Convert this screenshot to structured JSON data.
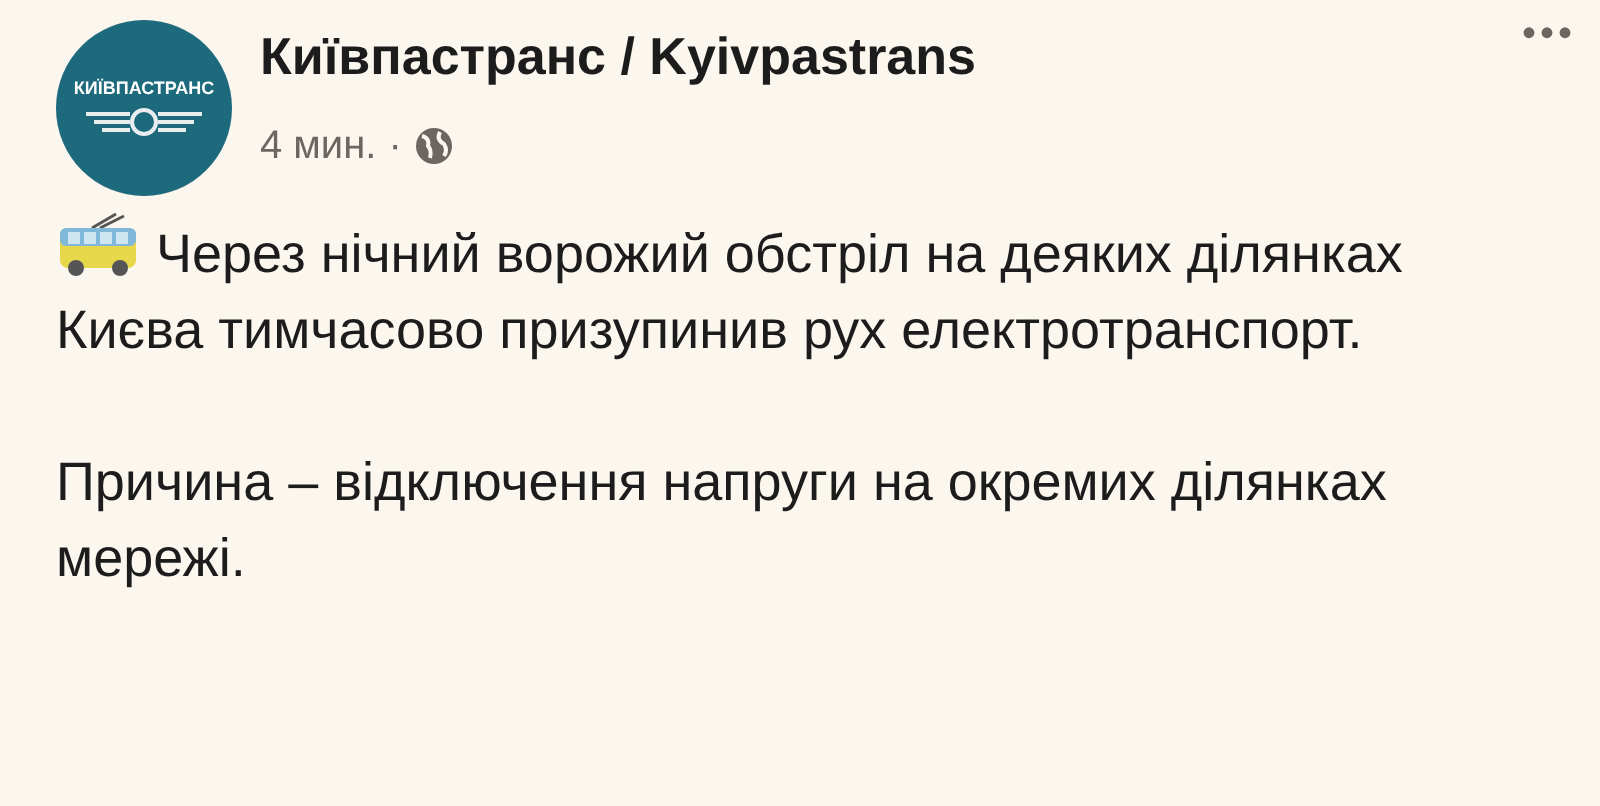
{
  "post": {
    "page_name": "Київпастранс / Kyivpastrans",
    "logo_text": "КИЇВПАСТРАНС",
    "time": "4 мин.",
    "separator": "·",
    "more": "•••",
    "paragraphs": [
      "Через нічний ворожий обстріл на деяких ділянках Києва тимчасово призупинив рух електротранспорт.",
      "Причина – відключення напруги на окремих ділянках мережі."
    ]
  }
}
